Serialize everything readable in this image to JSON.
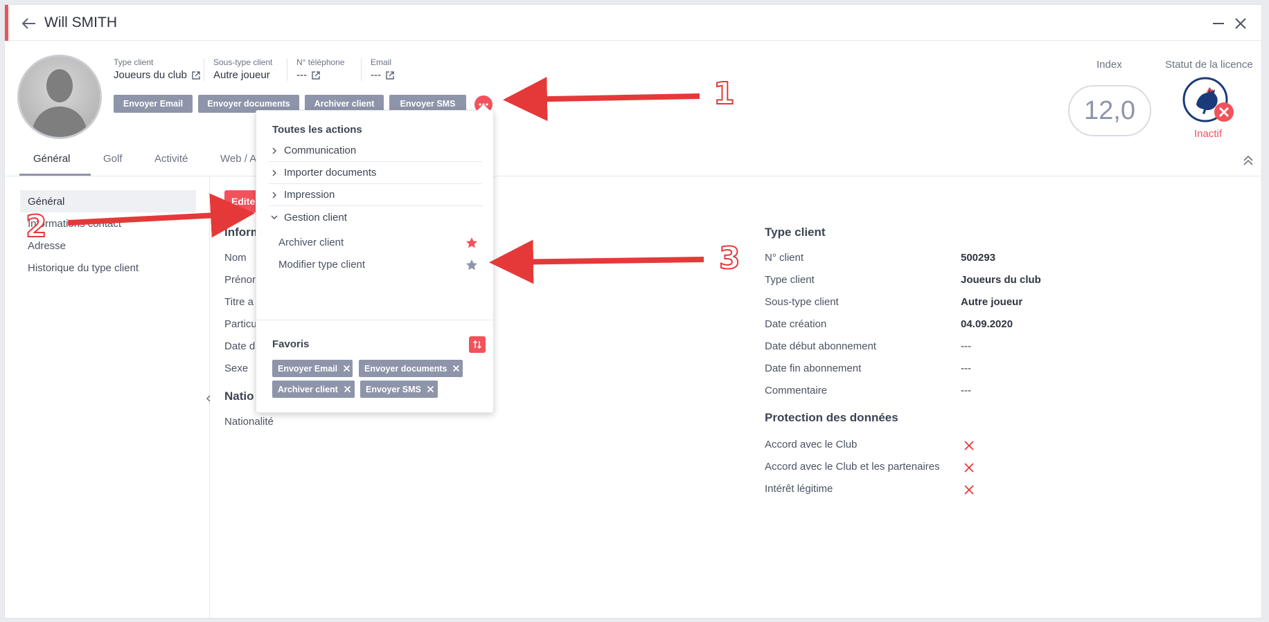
{
  "window": {
    "title": "Will SMITH"
  },
  "header": {
    "fields": [
      {
        "label": "Type client",
        "value": "Joueurs du club"
      },
      {
        "label": "Sous-type client",
        "value": "Autre joueur"
      },
      {
        "label": "N° téléphone",
        "value": "---"
      },
      {
        "label": "Email",
        "value": "---"
      }
    ],
    "actions": [
      "Envoyer Email",
      "Envoyer documents",
      "Archiver client",
      "Envoyer SMS"
    ],
    "index_label": "Index",
    "index_value": "12,0",
    "licence_label": "Statut de la licence",
    "licence_status": "Inactif"
  },
  "tabs": [
    "Général",
    "Golf",
    "Activité",
    "Web / A"
  ],
  "sidebar": {
    "items": [
      "Général",
      "Informations contact",
      "Adresse",
      "Historique du type client"
    ]
  },
  "main": {
    "edit_label": "Edite",
    "info_heading": "Inform",
    "info_fields": [
      "Nom",
      "Prénom",
      "Titre a",
      "Particu",
      "Date d",
      "Sexe"
    ],
    "nation_heading": "Natio",
    "nation_field": "Nationalité"
  },
  "type_client": {
    "heading": "Type client",
    "rows": [
      {
        "label": "N° client",
        "value": "500293"
      },
      {
        "label": "Type client",
        "value": "Joueurs du club"
      },
      {
        "label": "Sous-type client",
        "value": "Autre joueur"
      },
      {
        "label": "Date création",
        "value": "04.09.2020"
      },
      {
        "label": "Date début abonnement",
        "value": "---"
      },
      {
        "label": "Date fin abonnement",
        "value": "---"
      },
      {
        "label": "Commentaire",
        "value": "---"
      }
    ]
  },
  "data_protection": {
    "heading": "Protection des données",
    "rows": [
      "Accord avec le Club",
      "Accord avec le Club et les partenaires",
      "Intérêt légitime"
    ]
  },
  "menu": {
    "title": "Toutes les actions",
    "groups": [
      "Communication",
      "Importer documents",
      "Impression",
      "Gestion client"
    ],
    "sub_items": [
      "Archiver client",
      "Modifier type client"
    ],
    "favorites_title": "Favoris",
    "favorites": [
      "Envoyer Email",
      "Envoyer documents",
      "Archiver client",
      "Envoyer SMS"
    ]
  },
  "annotations": [
    "1",
    "2",
    "3"
  ],
  "colors": {
    "accent": "#f2525b",
    "button": "#8e95aa",
    "star_inactive": "#8e95aa"
  }
}
